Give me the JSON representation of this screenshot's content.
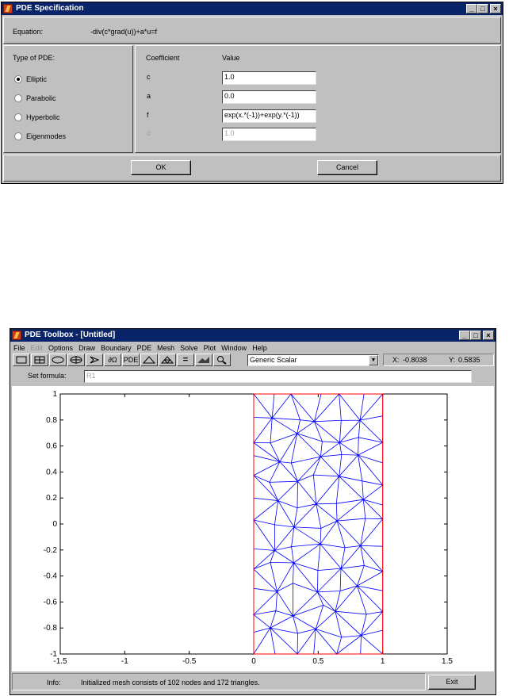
{
  "pde_dialog": {
    "title": "PDE Specification",
    "equation_label": "Equation:",
    "equation_value": "-div(c*grad(u))+a*u=f",
    "type_header": "Type of PDE:",
    "types": [
      {
        "label": "Elliptic",
        "selected": true
      },
      {
        "label": "Parabolic",
        "selected": false
      },
      {
        "label": "Hyperbolic",
        "selected": false
      },
      {
        "label": "Eigenmodes",
        "selected": false
      }
    ],
    "coef_header": "Coefficient",
    "value_header": "Value",
    "coefficients": [
      {
        "name": "c",
        "value": "1.0",
        "enabled": true
      },
      {
        "name": "a",
        "value": "0.0",
        "enabled": true
      },
      {
        "name": "f",
        "value": "exp(x.*(-1))+exp(y.*(-1))",
        "enabled": true
      },
      {
        "name": "d",
        "value": "1.0",
        "enabled": false
      }
    ],
    "ok_label": "OK",
    "cancel_label": "Cancel"
  },
  "toolbox": {
    "title": "PDE Toolbox - [Untitled]",
    "menu": [
      "File",
      "Edit",
      "Options",
      "Draw",
      "Boundary",
      "PDE",
      "Mesh",
      "Solve",
      "Plot",
      "Window",
      "Help"
    ],
    "menu_disabled": [
      "Edit"
    ],
    "toolbar_icons": [
      "rectangle-icon",
      "rectangle-center-icon",
      "ellipse-icon",
      "ellipse-center-icon",
      "polygon-icon",
      "boundary-mode-icon",
      "pde-spec-icon",
      "init-mesh-icon",
      "refine-mesh-icon",
      "solve-icon",
      "plot-icon",
      "zoom-icon"
    ],
    "toolbar_text": {
      "boundary": "∂Ω",
      "pde": "PDE",
      "equals": "="
    },
    "app_mode": "Generic Scalar",
    "x_label": "X:",
    "x_value": "-0.8038",
    "y_label": "Y:",
    "y_value": "0.5835",
    "set_formula_label": "Set formula:",
    "set_formula_value": "R1",
    "info_label": "Info:",
    "info_text": "Initialized mesh consists of 102 nodes and 172 triangles.",
    "exit_label": "Exit"
  },
  "chart_data": {
    "type": "mesh",
    "xlim": [
      -1.5,
      1.5
    ],
    "ylim": [
      -1,
      1
    ],
    "xticks": [
      "-1.5",
      "-1",
      "-0.5",
      "0",
      "0.5",
      "1",
      "1.5"
    ],
    "yticks": [
      "1",
      "0.8",
      "0.6",
      "0.4",
      "0.2",
      "0",
      "-0.2",
      "-0.4",
      "-0.6",
      "-0.8",
      "-1"
    ],
    "geometry": {
      "name": "R1",
      "x": [
        0,
        1
      ],
      "y": [
        -1,
        1
      ],
      "color": "#ff0000"
    },
    "mesh_color": "#0000ff",
    "nodes": 102,
    "triangles": 172
  }
}
